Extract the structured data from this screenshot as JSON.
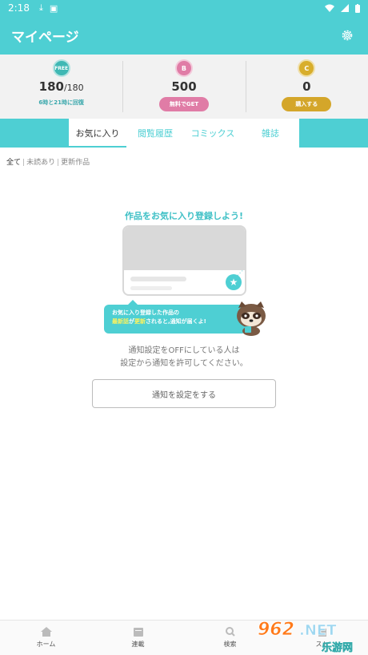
{
  "status_bar": {
    "time": "2:18"
  },
  "header": {
    "title": "マイページ"
  },
  "points": {
    "free": {
      "badge": "FREE",
      "value": "180",
      "max": "/180",
      "note": "6時と21時に回復"
    },
    "bonus": {
      "badge": "B",
      "value": "500",
      "button": "無料でGET"
    },
    "coin": {
      "badge": "C",
      "value": "0",
      "button": "購入する"
    }
  },
  "tabs": [
    {
      "label": "お気に入り",
      "active": true
    },
    {
      "label": "閲覧履歴"
    },
    {
      "label": "コミックス"
    },
    {
      "label": "雑誌"
    }
  ],
  "filters": [
    "全て",
    "未読あり",
    "更新作品"
  ],
  "empty_state": {
    "title": "作品をお気に入り登録しよう!",
    "bubble_line1": "お気に入り登録した作品の",
    "bubble_hl1": "最新話",
    "bubble_mid": "が",
    "bubble_hl2": "更新",
    "bubble_end": "されると,通知が届くよ!",
    "notice_line1": "通知設定をOFFにしている人は",
    "notice_line2": "設定から通知を許可してください。",
    "button": "通知を設定をする"
  },
  "bottom_nav": [
    {
      "label": "ホーム",
      "icon": "home-icon"
    },
    {
      "label": "連載",
      "icon": "calendar-icon"
    },
    {
      "label": "検索",
      "icon": "search-icon"
    },
    {
      "label": "スト",
      "icon": "store-icon"
    }
  ],
  "watermark": "962.NET 乐游网",
  "colors": {
    "accent": "#4ecfd3",
    "pink": "#e07ca6",
    "gold": "#d4a62a"
  }
}
